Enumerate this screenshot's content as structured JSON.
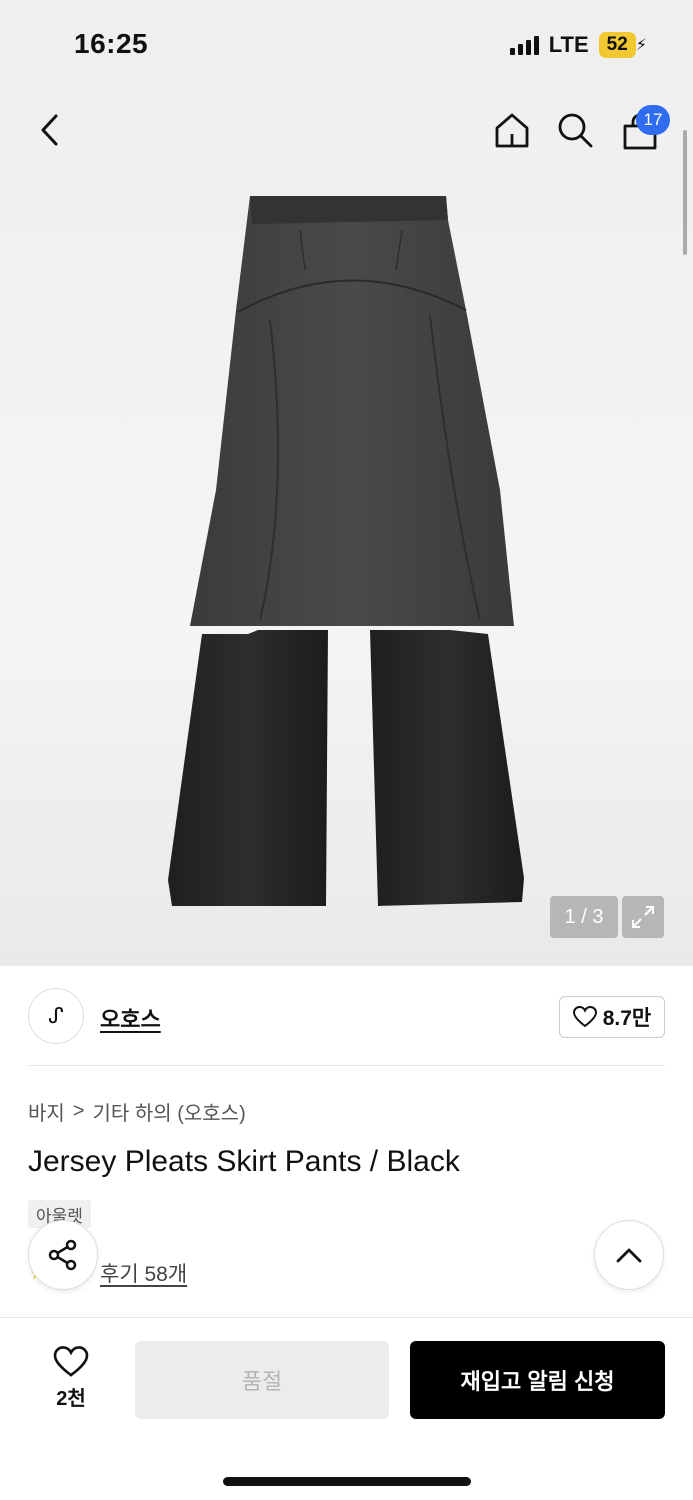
{
  "status": {
    "time": "16:25",
    "network": "LTE",
    "battery": "52"
  },
  "nav": {
    "cart_count": "17"
  },
  "gallery": {
    "page_indicator": "1 / 3"
  },
  "brand": {
    "logo_glyph": "ᔑ",
    "name": "오호스",
    "likes": "8.7만"
  },
  "breadcrumb": {
    "category": "바지",
    "separator": ">",
    "subcategory": "기타 하의 (오호스)"
  },
  "product": {
    "title": "Jersey Pleats Skirt Pants / Black",
    "tag": "아울렛",
    "reviews": "후기 58개"
  },
  "bottom": {
    "wish_count": "2천",
    "soldout_label": "품절",
    "restock_label": "재입고 알림 신청"
  },
  "icons": [
    "back-icon",
    "home-icon",
    "search-icon",
    "bag-icon",
    "expand-icon",
    "heart-icon",
    "share-icon",
    "chevron-up-icon",
    "star-icon"
  ]
}
